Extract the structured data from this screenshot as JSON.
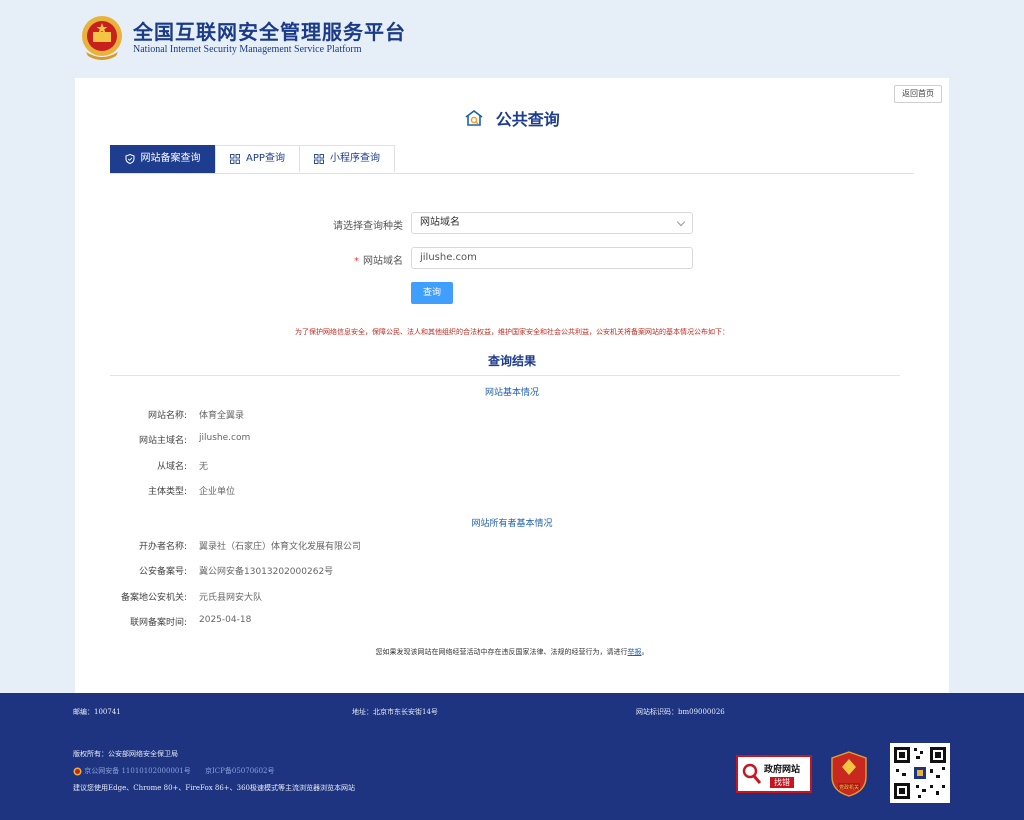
{
  "header": {
    "title": "全国互联网安全管理服务平台",
    "subtitle": "National Internet Security Management Service Platform"
  },
  "card": {
    "back_button": "返回首页",
    "page_title": "公共查询",
    "tabs": [
      {
        "label": "网站备案查询",
        "icon": "shield-icon",
        "active": true
      },
      {
        "label": "APP查询",
        "icon": "grid-icon",
        "active": false
      },
      {
        "label": "小程序查询",
        "icon": "grid-icon",
        "active": false
      }
    ],
    "form": {
      "type_label": "请选择查询种类",
      "type_value": "网站域名",
      "domain_label": "网站域名",
      "domain_required_mark": "*",
      "domain_value": "jilushe.com",
      "query_button": "查询"
    },
    "notice": "为了保护网络信息安全，保障公民、法人和其他组织的合法权益，维护国家安全和社会公共利益，公安机关将备案网站的基本情况公布如下：",
    "results_title": "查询结果",
    "basic_section_title": "网站基本情况",
    "basic_rows": [
      {
        "key": "网站名称:",
        "value": "体育全翼录"
      },
      {
        "key": "网站主域名:",
        "value": "jilushe.com"
      },
      {
        "key": "从域名:",
        "value": "无"
      },
      {
        "key": "主体类型:",
        "value": "企业单位"
      }
    ],
    "owner_section_title": "网站所有者基本情况",
    "owner_rows": [
      {
        "key": "开办者名称:",
        "value": "翼录社（石家庄）体育文化发展有限公司"
      },
      {
        "key": "公安备案号:",
        "value": "冀公网安备13013202000262号"
      },
      {
        "key": "备案地公安机关:",
        "value": "元氏县网安大队"
      },
      {
        "key": "联网备案时间:",
        "value": "2025-04-18"
      }
    ],
    "report_text": "您如果发现该网站在网络经营活动中存在违反国家法律、法规的经营行为，请进行",
    "report_link": "举报",
    "report_end": "。"
  },
  "footer": {
    "postcode": "邮编：100741",
    "address": "地址：北京市东长安街14号",
    "site_id": "网站标识码：bm09000026",
    "copyright": "版权所有：公安部网络安全保卫局",
    "police_record": "京公网安备 11010102000001号",
    "icp_record": "京ICP备05070602号",
    "browser_tip": "建议您使用Edge、Chrome 80+、FireFox 86+、360极速模式等主流浏览器浏览本网站",
    "badge_zhaocuo_line1": "政府网站",
    "badge_zhaocuo_line2": "找错",
    "badge_police_label": "党政机关"
  },
  "colors": {
    "primary_navy": "#1e3d8f",
    "footer_bg": "#1e3480",
    "page_bg": "#e6eff8",
    "query_button": "#409eff",
    "notice_red": "#c0281e"
  }
}
